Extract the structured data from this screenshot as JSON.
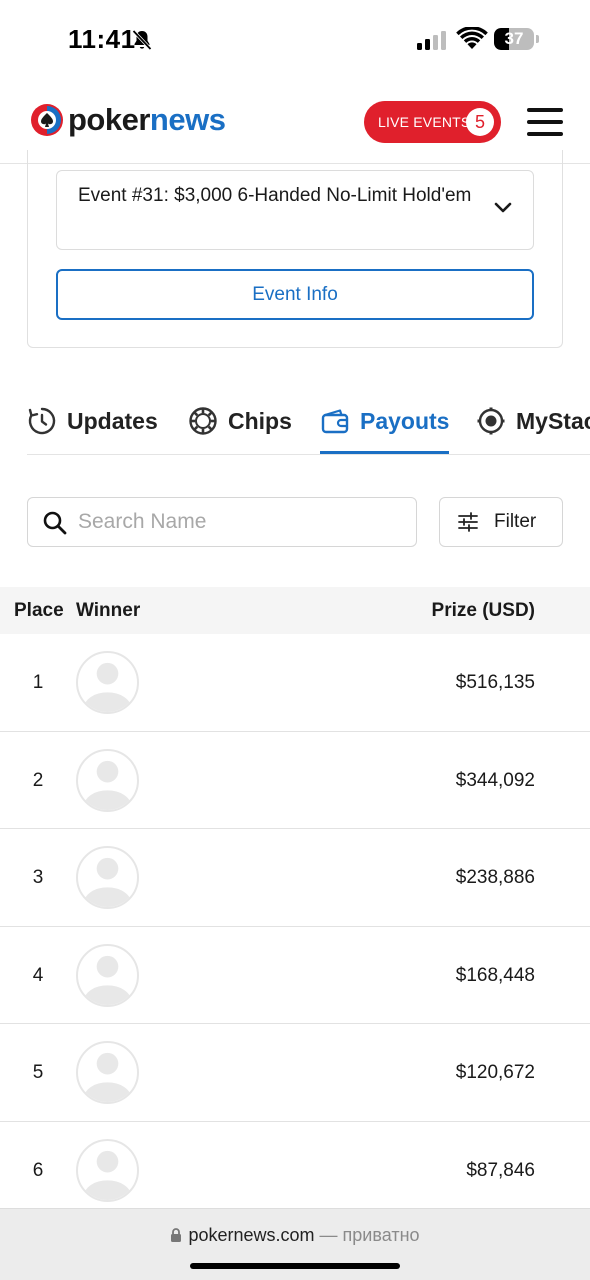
{
  "status_bar": {
    "time": "11:41",
    "battery_level": "37",
    "battery_fraction": 0.37
  },
  "header": {
    "logo_part1": "poker",
    "logo_part2": "news",
    "live_events_label": "LIVE EVENTS",
    "live_events_count": "5",
    "brand_color": "#1a6fc4",
    "live_color": "#e0202c"
  },
  "event": {
    "selected": "Event #31: $3,000 6-Handed No-Limit Hold'em",
    "info_button": "Event Info"
  },
  "tabs": [
    {
      "label": "Updates",
      "icon": "clock-icon",
      "active": false
    },
    {
      "label": "Chips",
      "icon": "chip-icon",
      "active": false
    },
    {
      "label": "Payouts",
      "icon": "wallet-icon",
      "active": true
    },
    {
      "label": "MyStac",
      "icon": "mystack-icon",
      "active": false
    }
  ],
  "search": {
    "placeholder": "Search Name",
    "value": ""
  },
  "filter": {
    "label": "Filter"
  },
  "table": {
    "headers": {
      "place": "Place",
      "winner": "Winner",
      "prize": "Prize (USD)"
    },
    "rows": [
      {
        "place": "1",
        "prize": "$516,135"
      },
      {
        "place": "2",
        "prize": "$344,092"
      },
      {
        "place": "3",
        "prize": "$238,886"
      },
      {
        "place": "4",
        "prize": "$168,448"
      },
      {
        "place": "5",
        "prize": "$120,672"
      },
      {
        "place": "6",
        "prize": "$87,846"
      }
    ]
  },
  "browser": {
    "domain": "pokernews.com",
    "status": " — приватно"
  }
}
